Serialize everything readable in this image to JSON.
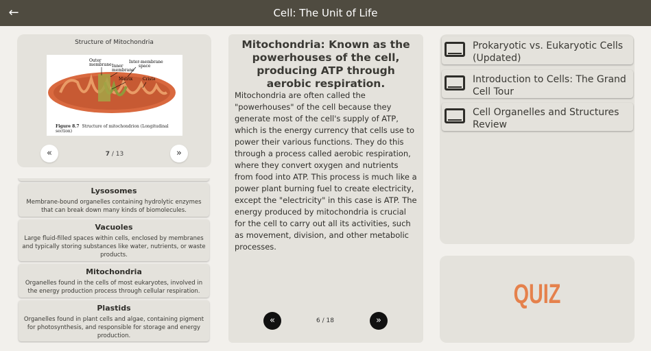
{
  "header": {
    "back_icon": "arrow-left-icon",
    "title": "Cell: The Unit of Life"
  },
  "figure_panel": {
    "title": "Structure of Mitochondria",
    "labels": {
      "outer": "Outer membrane",
      "outer_line1": "Outer",
      "outer_line2": "membrane",
      "inner_line1": "Inner",
      "inner_line2": "membrane",
      "intermembrane_line1": "Inter-membrane",
      "intermembrane_line2": "space",
      "matrix": "Matrix",
      "crista": "Crista"
    },
    "caption_bold": "Figure 8.7",
    "caption": "Structure of mitochondrion (Longitudinal section)",
    "prev_icon": "«",
    "next_icon": "»",
    "page_current": "7",
    "page_sep": " / ",
    "page_total": "13"
  },
  "organelles": [
    {
      "name": "Lysosomes",
      "desc": "Membrane-bound organelles containing hydrolytic enzymes that can break down many kinds of biomolecules."
    },
    {
      "name": "Vacuoles",
      "desc": "Large fluid-filled spaces within cells, enclosed by membranes and typically storing substances like water, nutrients, or waste products."
    },
    {
      "name": "Mitochondria",
      "desc": "Organelles found in the cells of most eukaryotes, involved in the energy production process through cellular respiration."
    },
    {
      "name": "Plastids",
      "desc": "Organelles found in plant cells and algae, containing pigment for photosynthesis, and responsible for storage and energy production."
    }
  ],
  "content": {
    "title": "Mitochondria: Known as the powerhouses of the cell, producing ATP through aerobic respiration.",
    "body": "Mitochondria are often called the \"powerhouses\" of the cell because they generate most of the cell's supply of ATP, which is the energy currency that cells use to power their various functions. They do this through a process called aerobic respiration, where they convert oxygen and nutrients from food into ATP. This process is much like a power plant burning fuel to create electricity, except the \"electricity\" in this case is ATP. The energy produced by mitochondria is crucial for the cell to carry out all its activities, such as movement, division, and other metabolic processes.",
    "prev_icon": "«",
    "next_icon": "»",
    "page": "6 / 18"
  },
  "videos": [
    {
      "icon": "video-icon",
      "label": "Prokaryotic vs. Eukaryotic Cells (Updated)"
    },
    {
      "icon": "video-icon",
      "label": "Introduction to Cells: The Grand Cell Tour"
    },
    {
      "icon": "video-icon",
      "label": "Cell Organelles and Structures Review"
    }
  ],
  "quiz": {
    "label": "QUIZ",
    "color": "#e5814c"
  }
}
